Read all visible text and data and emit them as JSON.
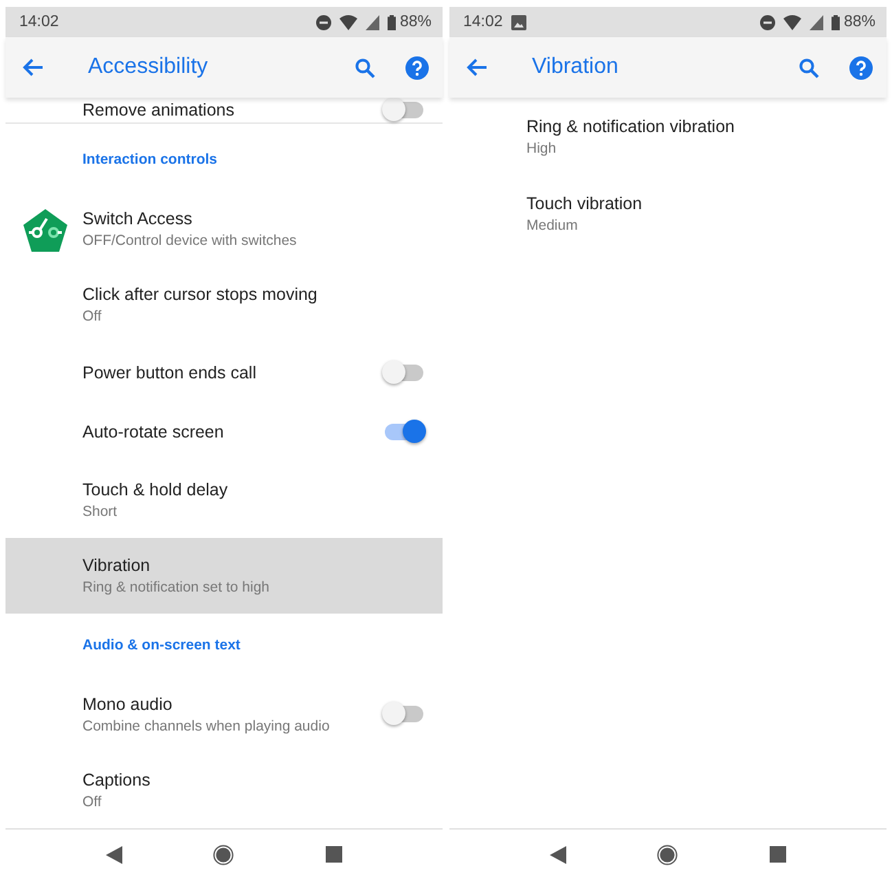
{
  "screens": [
    {
      "status": {
        "time": "14:02",
        "battery": "88%",
        "image_notification": false
      },
      "title": "Accessibility",
      "items": [
        {
          "kind": "toggle",
          "title": "Remove animations",
          "on": false,
          "selected": false
        },
        {
          "kind": "header",
          "title": "Interaction controls"
        },
        {
          "kind": "app",
          "title": "Switch Access",
          "summary": "OFF/Control device with switches",
          "selected": false
        },
        {
          "kind": "pref",
          "title": "Click after cursor stops moving",
          "summary": "Off",
          "selected": false
        },
        {
          "kind": "toggle",
          "title": "Power button ends call",
          "on": false,
          "selected": false
        },
        {
          "kind": "toggle",
          "title": "Auto-rotate screen",
          "on": true,
          "selected": false
        },
        {
          "kind": "pref",
          "title": "Touch & hold delay",
          "summary": "Short",
          "selected": false
        },
        {
          "kind": "pref",
          "title": "Vibration",
          "summary": "Ring & notification set to high",
          "selected": true
        },
        {
          "kind": "header",
          "title": "Audio & on-screen text"
        },
        {
          "kind": "toggle",
          "title": "Mono audio",
          "summary": "Combine channels when playing audio",
          "on": false,
          "selected": false
        },
        {
          "kind": "pref",
          "title": "Captions",
          "summary": "Off",
          "selected": false
        }
      ]
    },
    {
      "status": {
        "time": "14:02",
        "battery": "88%",
        "image_notification": true
      },
      "title": "Vibration",
      "items": [
        {
          "kind": "pref",
          "title": "Ring & notification vibration",
          "summary": "High",
          "selected": false
        },
        {
          "kind": "pref",
          "title": "Touch vibration",
          "summary": "Medium",
          "selected": false
        }
      ]
    }
  ]
}
